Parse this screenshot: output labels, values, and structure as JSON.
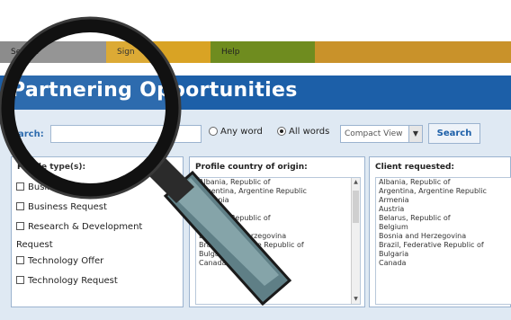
{
  "nav": {
    "items": [
      {
        "label": "Search",
        "color": "#8c8c8c"
      },
      {
        "label": "Sign",
        "color": "#d9a324"
      },
      {
        "label": "Help",
        "color": "#6f8c1f"
      },
      {
        "label": "",
        "color": "#c9922a"
      }
    ]
  },
  "page": {
    "title": "Partnering Opportunities"
  },
  "search": {
    "label": "Search:",
    "value": "",
    "mode_any": "Any word",
    "mode_all": "All words",
    "mode_selected": "All words",
    "view_select": "Compact View",
    "button": "Search"
  },
  "profile_types": {
    "title": "Profile type(s):",
    "items": [
      "Business Offer",
      "Business Request",
      "Research & Development"
    ],
    "request_heading": "Request",
    "request_items": [
      "Technology Offer",
      "Technology Request"
    ]
  },
  "profile_country": {
    "title": "Profile country of origin:",
    "items": [
      "Albania, Republic of",
      "Argentina, Argentine Republic",
      "Armenia",
      "Austria",
      "Belarus, Republic of",
      "Belgium",
      "Bosnia and Herzegovina",
      "Brazil, Federative Republic of",
      "Bulgaria",
      "Canada"
    ]
  },
  "client_requested": {
    "title": "Client requested:",
    "items": [
      "Albania, Republic of",
      "Argentina, Argentine Republic",
      "Armenia",
      "Austria",
      "Belarus, Republic of",
      "Belgium",
      "Bosnia and Herzegovina",
      "Brazil, Federative Republic of",
      "Bulgaria",
      "Canada"
    ]
  },
  "colors": {
    "brand_blue": "#1c5fa8",
    "panel": "#dfe9f3"
  },
  "icons": {
    "overlay": "magnifying-glass-icon",
    "dropdown": "chevron-down-icon"
  }
}
